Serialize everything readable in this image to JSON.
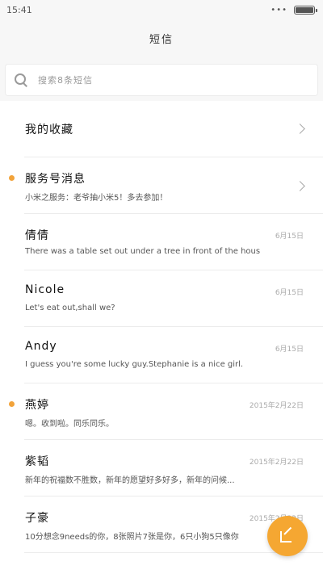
{
  "status_bar": {
    "time": "15:41",
    "menu_dots": "•••",
    "battery_level": 1.0
  },
  "title": "短信",
  "search": {
    "placeholder": "搜索8条短信"
  },
  "conversations": [
    {
      "name": "我的收藏",
      "preview": "",
      "time": "",
      "unread": false,
      "chevron": true
    },
    {
      "name": "服务号消息",
      "preview": "小米之服务：老爷抽小米5！多去参加！",
      "time": "",
      "unread": true,
      "chevron": true
    },
    {
      "name": "倩倩",
      "preview": "There was a table set out under a tree in front of the hous",
      "time": "6月15日",
      "unread": false,
      "chevron": false
    },
    {
      "name": "Nicole",
      "preview": "Let's eat out,shall we?",
      "time": "6月15日",
      "unread": false,
      "chevron": false
    },
    {
      "name": "Andy",
      "preview": "I guess you're some lucky guy.Stephanie is a nice girl.",
      "time": "6月15日",
      "unread": false,
      "chevron": false
    },
    {
      "name": "燕婷",
      "preview": "嗯。收到啦。同乐同乐。",
      "time": "2015年2月22日",
      "unread": true,
      "chevron": false
    },
    {
      "name": "紫韬",
      "preview": "新年的祝福数不胜数，新年的愿望好多好多，新年的问候...",
      "time": "2015年2月22日",
      "unread": false,
      "chevron": false
    },
    {
      "name": "子豪",
      "preview": "10分想念9needs的你，8张照片7张是你，6只小狗5只像你",
      "time": "2015年2月22日",
      "unread": false,
      "chevron": false
    }
  ],
  "fab": {
    "icon": "compose-icon",
    "color": "#f5a732"
  },
  "colors": {
    "accent": "#f2a33a"
  }
}
